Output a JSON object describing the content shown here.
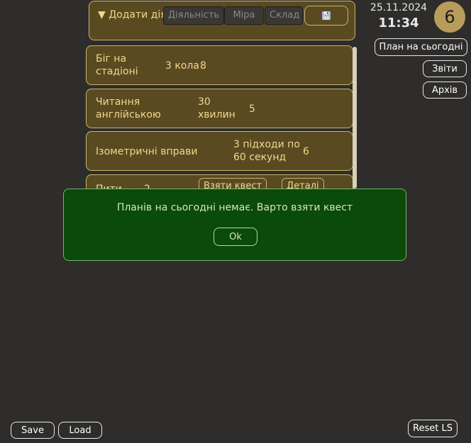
{
  "add_activity": {
    "toggle": "▼",
    "title": "Додати діяльність",
    "activity_placeholder": "Діяльність",
    "measure_placeholder": "Міра",
    "difficulty_placeholder": "Склад"
  },
  "activities": [
    {
      "name": "Біг на стадіоні",
      "measure": "3 кола",
      "value": "8"
    },
    {
      "name": "Читання англійською",
      "measure": "30 хвилин",
      "value": "5"
    },
    {
      "name": "Ізометричні вправи",
      "measure": "3 підходи по 60 секунд",
      "value": "6"
    },
    {
      "name": "Пити",
      "measure": "2",
      "value": "",
      "take_quest": "Взяти квест",
      "details": "Деталі"
    }
  ],
  "header": {
    "date": "25.11.2024",
    "time": "11:34",
    "level": "6"
  },
  "side_buttons": {
    "plan_today": "План на сьогодні",
    "reports": "Звіти",
    "archive": "Архів"
  },
  "modal": {
    "message": "Планів на сьогодні немає. Варто взяти квест",
    "ok": "Ok"
  },
  "footer": {
    "save": "Save",
    "load": "Load",
    "reset": "Reset LS"
  },
  "colors": {
    "panel_bg": "#5a4a22",
    "panel_border": "#c8b46a",
    "text_gold": "#f0d98a",
    "modal_bg": "#0a4a0a",
    "page_bg": "#2e2d2b"
  },
  "icons": {
    "save_icon": "floppy-disk-icon"
  }
}
